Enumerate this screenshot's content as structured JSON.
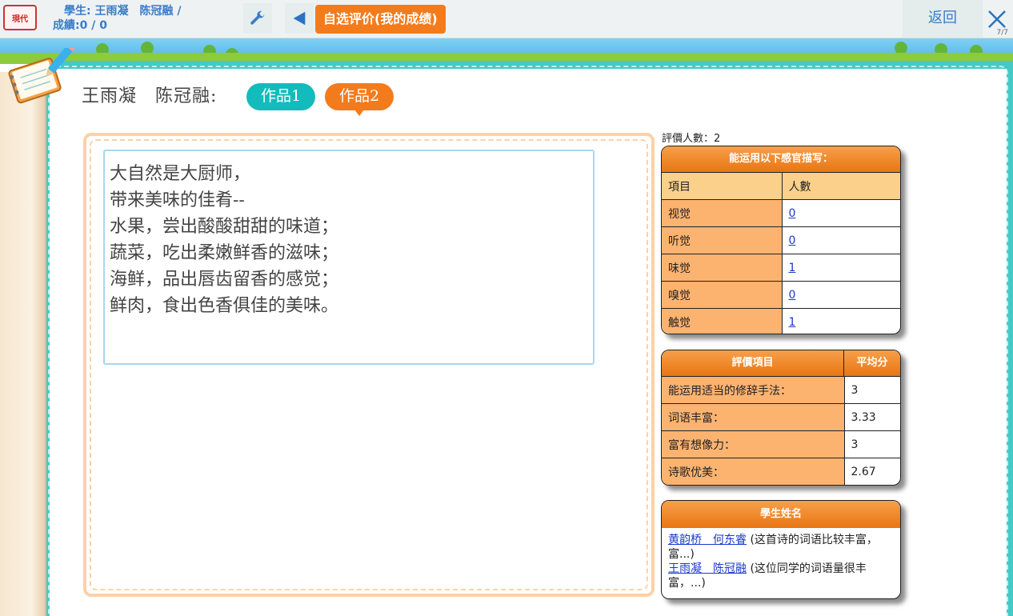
{
  "topbar": {
    "logo_text": "現代",
    "student_line": "學生: 王雨凝　陈冠融  /",
    "score_line": "成績:0 / 0",
    "title": "自选评价(我的成绩)",
    "back_label": "返回",
    "page_counter": "7/7",
    "icons": [
      "wrench-icon",
      "prev-arrow-icon",
      "close-icon"
    ]
  },
  "work": {
    "heading": "王雨凝　陈冠融:",
    "tabs": [
      {
        "label": "作品1",
        "active": false,
        "color": "#13bcbc"
      },
      {
        "label": "作品2",
        "active": true,
        "color": "#f47b1b"
      }
    ],
    "poem_lines": [
      "大自然是大厨师，",
      "带来美味的佳肴--",
      "水果，尝出酸酸甜甜的味道；",
      "蔬菜，吃出柔嫩鲜香的滋味；",
      "海鲜，品出唇齿留香的感觉；",
      "鲜肉，食出色香俱佳的美味。"
    ]
  },
  "rating": {
    "count_label": "評價人數：2",
    "senses": {
      "title": "能运用以下感官描写：",
      "col_item": "項目",
      "col_count": "人數",
      "rows": [
        {
          "item": "视觉",
          "count": "0"
        },
        {
          "item": "听觉",
          "count": "0"
        },
        {
          "item": "味觉",
          "count": "1"
        },
        {
          "item": "嗅觉",
          "count": "0"
        },
        {
          "item": "触觉",
          "count": "1"
        }
      ]
    },
    "scores": {
      "col_item": "評價項目",
      "col_avg": "平均分",
      "rows": [
        {
          "item": "能运用适当的修辞手法：",
          "avg": "3"
        },
        {
          "item": "词语丰富：",
          "avg": "3.33"
        },
        {
          "item": "富有想像力：",
          "avg": "3"
        },
        {
          "item": "诗歌优美：",
          "avg": "2.67"
        }
      ]
    },
    "students": {
      "title": "學生姓名",
      "comments": [
        {
          "names": "黄韵桥　何东睿",
          "text": " (这首诗的词语比较丰富，富...)"
        },
        {
          "names": "王雨凝　陈冠融",
          "text": " (这位同学的词语量很丰富，...)"
        }
      ]
    }
  },
  "colors": {
    "accent_orange": "#f47b1b",
    "accent_teal": "#13bcbc",
    "link_blue": "#1a3acb",
    "header_blue": "#3a7cc7"
  }
}
